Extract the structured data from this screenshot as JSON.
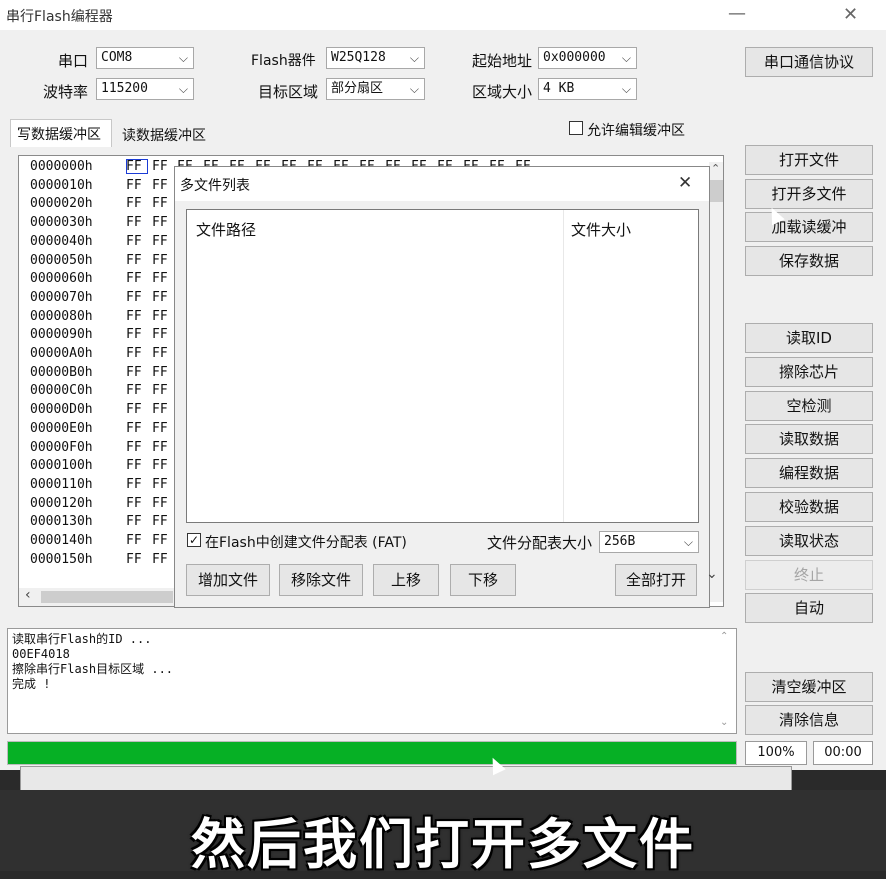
{
  "window": {
    "title": "串行Flash编程器",
    "minimize": "—",
    "close": "✕"
  },
  "settings": {
    "port_label": "串口",
    "port_value": "COM8",
    "baud_label": "波特率",
    "baud_value": "115200",
    "flash_label": "Flash器件",
    "flash_value": "W25Q128",
    "target_label": "目标区域",
    "target_value": "部分扇区",
    "start_label": "起始地址",
    "start_value": "0x000000",
    "size_label": "区域大小",
    "size_value": "4 KB"
  },
  "protocol_button": "串口通信协议",
  "tabs": {
    "write": "写数据缓冲区",
    "read": "读数据缓冲区"
  },
  "allow_edit": "允许编辑缓冲区",
  "hex": {
    "rows": [
      "0000000h",
      "0000010h",
      "0000020h",
      "0000030h",
      "0000040h",
      "0000050h",
      "0000060h",
      "0000070h",
      "0000080h",
      "0000090h",
      "00000A0h",
      "00000B0h",
      "00000C0h",
      "00000D0h",
      "00000E0h",
      "00000F0h",
      "0000100h",
      "0000110h",
      "0000120h",
      "0000130h",
      "0000140h",
      "0000150h"
    ],
    "byte": "FF"
  },
  "right_buttons": {
    "open_file": "打开文件",
    "open_multi": "打开多文件",
    "load_read": "加载读缓冲",
    "save_data": "保存数据",
    "read_id": "读取ID",
    "erase_chip": "擦除芯片",
    "blank_check": "空检测",
    "read_data": "读取数据",
    "program_data": "编程数据",
    "verify_data": "校验数据",
    "read_status": "读取状态",
    "stop": "终止",
    "auto": "自动",
    "clear_buffer": "清空缓冲区",
    "clear_info": "清除信息"
  },
  "log": [
    "读取串行Flash的ID ...",
    "00EF4018",
    "擦除串行Flash目标区域 ...",
    "完成 !"
  ],
  "progress": {
    "percent": 100,
    "percent_text": "100%",
    "time": "00:00"
  },
  "dialog": {
    "title": "多文件列表",
    "col_path": "文件路径",
    "col_size": "文件大小",
    "fat_checkbox": "在Flash中创建文件分配表 (FAT)",
    "fat_size_label": "文件分配表大小",
    "fat_size_value": "256B",
    "buttons": {
      "add": "增加文件",
      "remove": "移除文件",
      "up": "上移",
      "down": "下移",
      "open_all": "全部打开"
    }
  },
  "subtitle": "然后我们打开多文件"
}
